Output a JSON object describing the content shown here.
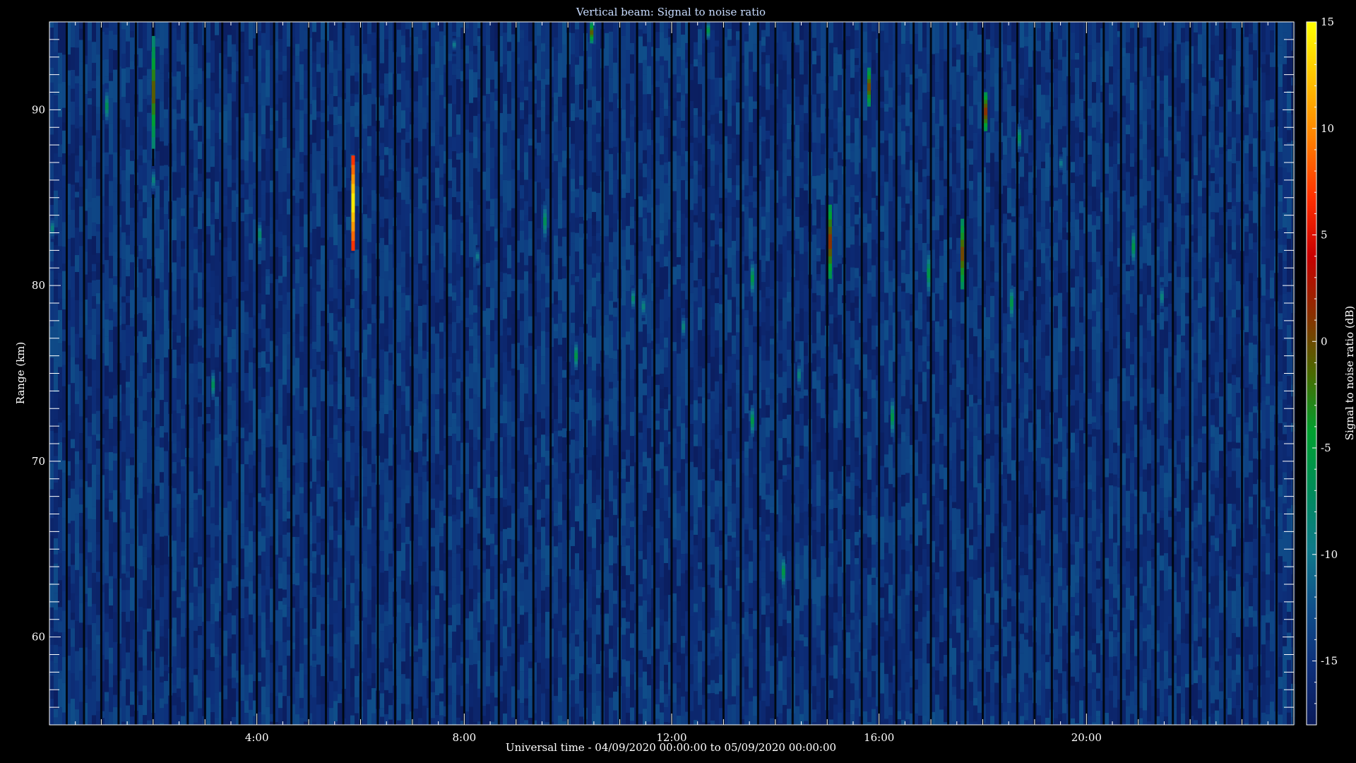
{
  "chart_data": {
    "type": "heatmap",
    "title": "Vertical beam: Signal to noise ratio",
    "xlabel": "Universal time - 04/09/2020 00:00:00 to 05/09/2020 00:00:00",
    "ylabel": "Range (km)",
    "xlim_hours": [
      0,
      24
    ],
    "ylim_km": [
      55,
      95
    ],
    "x_ticks": [
      {
        "hour": 4,
        "label": "4:00"
      },
      {
        "hour": 8,
        "label": "8:00"
      },
      {
        "hour": 12,
        "label": "12:00"
      },
      {
        "hour": 16,
        "label": "16:00"
      },
      {
        "hour": 20,
        "label": "20:00"
      }
    ],
    "y_ticks": [
      {
        "km": 60,
        "label": "60"
      },
      {
        "km": 70,
        "label": "70"
      },
      {
        "km": 80,
        "label": "80"
      },
      {
        "km": 90,
        "label": "90"
      }
    ],
    "colorbar": {
      "label": "Signal to noise ratio (dB)",
      "range_db": [
        -18,
        15
      ],
      "ticks": [
        {
          "db": 15,
          "label": "15"
        },
        {
          "db": 10,
          "label": "10"
        },
        {
          "db": 5,
          "label": "5"
        },
        {
          "db": 0,
          "label": "0"
        },
        {
          "db": -5,
          "label": "-5"
        },
        {
          "db": -10,
          "label": "-10"
        },
        {
          "db": -15,
          "label": "-15"
        }
      ],
      "colors": [
        "#0a1a5a",
        "#0d2f7a",
        "#0f4f8a",
        "#0f7a8a",
        "#008c5a",
        "#00a030",
        "#4a6a00",
        "#8a3000",
        "#c80000",
        "#ff3000",
        "#ff8000",
        "#ffc000",
        "#ffff00"
      ]
    },
    "background_snr_db": -16,
    "echoes": [
      {
        "hour": 1.1,
        "km_from": 89.2,
        "km_to": 91.2,
        "peak_db": -6
      },
      {
        "hour": 2.0,
        "km_from": 87.8,
        "km_to": 94.2,
        "peak_db": 0
      },
      {
        "hour": 2.0,
        "km_from": 85.2,
        "km_to": 86.8,
        "peak_db": -8
      },
      {
        "hour": 3.15,
        "km_from": 73.5,
        "km_to": 75.2,
        "peak_db": -6
      },
      {
        "hour": 4.05,
        "km_from": 82.0,
        "km_to": 83.8,
        "peak_db": -7
      },
      {
        "hour": 5.85,
        "km_from": 82.0,
        "km_to": 87.4,
        "peak_db": 15
      },
      {
        "hour": 7.8,
        "km_from": 93.2,
        "km_to": 94.2,
        "peak_db": -9
      },
      {
        "hour": 8.25,
        "km_from": 81.0,
        "km_to": 82.3,
        "peak_db": -9
      },
      {
        "hour": 9.55,
        "km_from": 82.5,
        "km_to": 84.8,
        "peak_db": -6
      },
      {
        "hour": 10.15,
        "km_from": 75.2,
        "km_to": 76.8,
        "peak_db": -5
      },
      {
        "hour": 10.45,
        "km_from": 93.8,
        "km_to": 95.0,
        "peak_db": 0
      },
      {
        "hour": 11.25,
        "km_from": 78.5,
        "km_to": 80.0,
        "peak_db": -7
      },
      {
        "hour": 11.45,
        "km_from": 78.0,
        "km_to": 79.6,
        "peak_db": -8
      },
      {
        "hour": 12.22,
        "km_from": 76.8,
        "km_to": 78.5,
        "peak_db": -8
      },
      {
        "hour": 12.7,
        "km_from": 94.0,
        "km_to": 95.0,
        "peak_db": -5
      },
      {
        "hour": 13.55,
        "km_from": 79.4,
        "km_to": 81.4,
        "peak_db": -5
      },
      {
        "hour": 13.55,
        "km_from": 71.4,
        "km_to": 73.2,
        "peak_db": -5
      },
      {
        "hour": 14.15,
        "km_from": 62.8,
        "km_to": 64.6,
        "peak_db": -5
      },
      {
        "hour": 14.45,
        "km_from": 74.0,
        "km_to": 75.8,
        "peak_db": -8
      },
      {
        "hour": 15.05,
        "km_from": 80.4,
        "km_to": 84.6,
        "peak_db": 2
      },
      {
        "hour": 15.8,
        "km_from": 90.2,
        "km_to": 92.4,
        "peak_db": 1
      },
      {
        "hour": 16.25,
        "km_from": 71.4,
        "km_to": 73.6,
        "peak_db": -5
      },
      {
        "hour": 16.95,
        "km_from": 79.4,
        "km_to": 82.0,
        "peak_db": -5
      },
      {
        "hour": 17.6,
        "km_from": 79.8,
        "km_to": 83.8,
        "peak_db": 1
      },
      {
        "hour": 18.05,
        "km_from": 88.8,
        "km_to": 91.0,
        "peak_db": 2
      },
      {
        "hour": 18.55,
        "km_from": 78.0,
        "km_to": 80.0,
        "peak_db": -5
      },
      {
        "hour": 18.7,
        "km_from": 87.6,
        "km_to": 89.2,
        "peak_db": -6
      },
      {
        "hour": 19.5,
        "km_from": 86.3,
        "km_to": 87.6,
        "peak_db": -9
      },
      {
        "hour": 20.9,
        "km_from": 81.2,
        "km_to": 83.2,
        "peak_db": -5
      },
      {
        "hour": 21.45,
        "km_from": 78.5,
        "km_to": 80.2,
        "peak_db": -8
      },
      {
        "hour": 0.05,
        "km_from": 82.5,
        "km_to": 84.0,
        "peak_db": -8
      }
    ]
  }
}
